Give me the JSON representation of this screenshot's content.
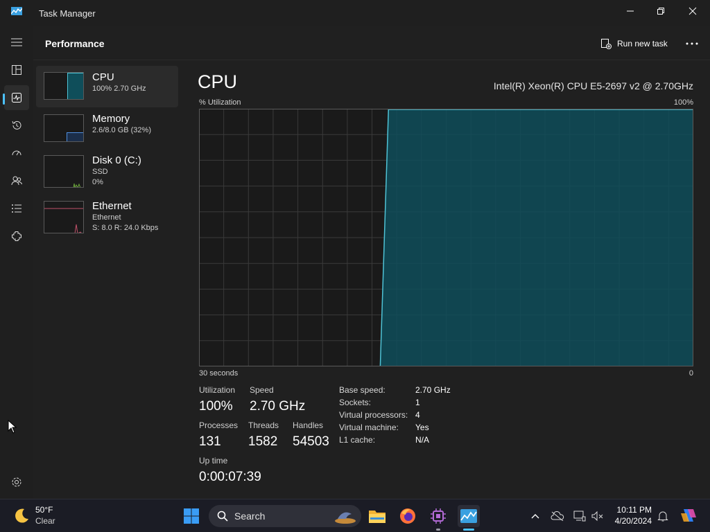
{
  "window": {
    "title": "Task Manager"
  },
  "header": {
    "page_title": "Performance",
    "run_new_task_label": "Run new task"
  },
  "resources": [
    {
      "name": "CPU",
      "sub1": "100% 2.70 GHz",
      "sub2": "",
      "selected": true,
      "usage": 1.0
    },
    {
      "name": "Memory",
      "sub1": "2.6/8.0 GB (32%)",
      "sub2": "",
      "selected": false,
      "usage": 0.32
    },
    {
      "name": "Disk 0 (C:)",
      "sub1": "SSD",
      "sub2": "0%",
      "selected": false,
      "usage": 0.0
    },
    {
      "name": "Ethernet",
      "sub1": "Ethernet",
      "sub2": "S: 8.0  R: 24.0 Kbps",
      "selected": false,
      "usage": 0.0
    }
  ],
  "detail": {
    "title": "CPU",
    "model": "Intel(R) Xeon(R) CPU E5-2697 v2 @ 2.70GHz",
    "graph_top_left": "% Utilization",
    "graph_top_right": "100%",
    "graph_bottom_left": "30 seconds",
    "graph_bottom_right": "0",
    "stats": {
      "utilization_label": "Utilization",
      "utilization_value": "100%",
      "speed_label": "Speed",
      "speed_value": "2.70 GHz",
      "processes_label": "Processes",
      "processes_value": "131",
      "threads_label": "Threads",
      "threads_value": "1582",
      "handles_label": "Handles",
      "handles_value": "54503",
      "uptime_label": "Up time",
      "uptime_value": "0:00:07:39"
    },
    "info": [
      {
        "key": "Base speed:",
        "value": "2.70 GHz"
      },
      {
        "key": "Sockets:",
        "value": "1"
      },
      {
        "key": "Virtual processors:",
        "value": "4"
      },
      {
        "key": "Virtual machine:",
        "value": "Yes"
      },
      {
        "key": "L1 cache:",
        "value": "N/A"
      }
    ]
  },
  "chart_data": {
    "type": "area",
    "x_range_seconds": [
      30,
      0
    ],
    "ylim": [
      0,
      100
    ],
    "series": [
      {
        "values": [
          0,
          0,
          0,
          0,
          0,
          0,
          0,
          0,
          0,
          0,
          0,
          0,
          0,
          0,
          0,
          0,
          0,
          0,
          0,
          0,
          0,
          0,
          0,
          100,
          100,
          100,
          100,
          100,
          100,
          100,
          100,
          100,
          100,
          100,
          100,
          100,
          100,
          100,
          100,
          100,
          100,
          100,
          100,
          100,
          100,
          100,
          100,
          100,
          100,
          100,
          100,
          100,
          100,
          100,
          100,
          100,
          100,
          100,
          100,
          100,
          100
        ]
      }
    ],
    "grid": true,
    "colors": {
      "line": "#4fc3d6",
      "fill": "#0f4e5a",
      "grid": "#3a3a3a",
      "border": "#5a5a5a"
    }
  },
  "taskbar": {
    "weather_temp": "50°F",
    "weather_condition": "Clear",
    "search_label": "Search",
    "time": "10:11 PM",
    "date": "4/20/2024"
  },
  "colors": {
    "accent": "#4cc2ff",
    "graph_fill": "#0f4e5a",
    "graph_line": "#4fc3d6"
  }
}
